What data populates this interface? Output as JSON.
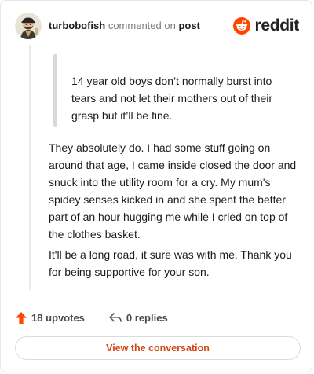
{
  "comment": {
    "username": "turbobofish",
    "action_text": " commented on ",
    "post_link": "post",
    "quote": "14 year old boys don’t normally burst into tears and not let their mothers out of their grasp but it’ll be fine.",
    "paragraphs": [
      "They absolutely do. I had some stuff going on around that age, I came inside closed the door and snuck into the utility room for a cry. My mum's spidey senses kicked in and she spent the better part of an hour hugging me while I cried on top of the clothes basket.",
      "It'll be a long road, it sure was with me. Thank you for being supportive for your son."
    ]
  },
  "brand": {
    "logo_text": "reddit",
    "accent": "#ff4500"
  },
  "footer": {
    "upvotes_label": "18 upvotes",
    "upvote_icon": "upvote-arrow-icon",
    "replies_label": "0 replies",
    "reply_icon": "reply-icon"
  },
  "cta": {
    "label": "View the conversation"
  }
}
